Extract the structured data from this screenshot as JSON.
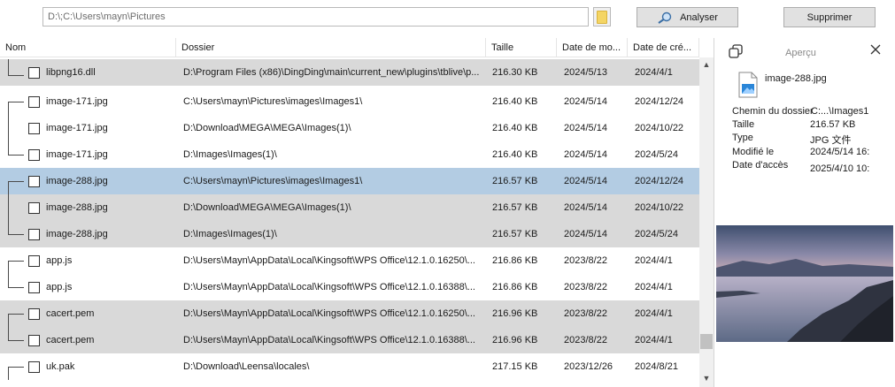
{
  "toolbar": {
    "path_value": "D:\\;C:\\Users\\mayn\\Pictures",
    "analyse_label": "Analyser",
    "delete_label": "Supprimer"
  },
  "columns": {
    "name": "Nom",
    "folder": "Dossier",
    "size": "Taille",
    "modified": "Date de mo...",
    "created": "Date de cré..."
  },
  "rows": [
    {
      "name": "libpng16.dll",
      "folder": "D:\\Program Files (x86)\\DingDing\\main\\current_new\\plugins\\tblive\\p...",
      "size": "216.30 KB",
      "modified": "2024/5/13",
      "created": "2024/4/1"
    },
    {
      "name": "image-171.jpg",
      "folder": "C:\\Users\\mayn\\Pictures\\images\\Images1\\",
      "size": "216.40 KB",
      "modified": "2024/5/14",
      "created": "2024/12/24"
    },
    {
      "name": "image-171.jpg",
      "folder": "D:\\Download\\MEGA\\MEGA\\Images(1)\\",
      "size": "216.40 KB",
      "modified": "2024/5/14",
      "created": "2024/10/22"
    },
    {
      "name": "image-171.jpg",
      "folder": "D:\\Images\\Images(1)\\",
      "size": "216.40 KB",
      "modified": "2024/5/14",
      "created": "2024/5/24"
    },
    {
      "name": "image-288.jpg",
      "folder": "C:\\Users\\mayn\\Pictures\\images\\Images1\\",
      "size": "216.57 KB",
      "modified": "2024/5/14",
      "created": "2024/12/24"
    },
    {
      "name": "image-288.jpg",
      "folder": "D:\\Download\\MEGA\\MEGA\\Images(1)\\",
      "size": "216.57 KB",
      "modified": "2024/5/14",
      "created": "2024/10/22"
    },
    {
      "name": "image-288.jpg",
      "folder": "D:\\Images\\Images(1)\\",
      "size": "216.57 KB",
      "modified": "2024/5/14",
      "created": "2024/5/24"
    },
    {
      "name": "app.js",
      "folder": "D:\\Users\\Mayn\\AppData\\Local\\Kingsoft\\WPS Office\\12.1.0.16250\\...",
      "size": "216.86 KB",
      "modified": "2023/8/22",
      "created": "2024/4/1"
    },
    {
      "name": "app.js",
      "folder": "D:\\Users\\Mayn\\AppData\\Local\\Kingsoft\\WPS Office\\12.1.0.16388\\...",
      "size": "216.86 KB",
      "modified": "2023/8/22",
      "created": "2024/4/1"
    },
    {
      "name": "cacert.pem",
      "folder": "D:\\Users\\Mayn\\AppData\\Local\\Kingsoft\\WPS Office\\12.1.0.16250\\...",
      "size": "216.96 KB",
      "modified": "2023/8/22",
      "created": "2024/4/1"
    },
    {
      "name": "cacert.pem",
      "folder": "D:\\Users\\Mayn\\AppData\\Local\\Kingsoft\\WPS Office\\12.1.0.16388\\...",
      "size": "216.96 KB",
      "modified": "2023/8/22",
      "created": "2024/4/1"
    },
    {
      "name": "uk.pak",
      "folder": "D:\\Download\\Leensa\\locales\\",
      "size": "217.15 KB",
      "modified": "2023/12/26",
      "created": "2024/8/21"
    }
  ],
  "preview": {
    "title": "Aperçu",
    "filename": "image-288.jpg",
    "labels": {
      "path": "Chemin du dossier",
      "size": "Taille",
      "type": "Type",
      "modified": "Modifié le",
      "accessed": "Date d'accès"
    },
    "values": {
      "path": "C:...\\Images1",
      "size": "216.57 KB",
      "type": "JPG 文件",
      "modified": "2024/5/14 16:",
      "accessed": "2025/4/10 10:"
    }
  },
  "colors": {
    "row_gray": "#d9d9d9",
    "row_selected": "#b3cce3",
    "button_bg": "#e1e1e1"
  }
}
